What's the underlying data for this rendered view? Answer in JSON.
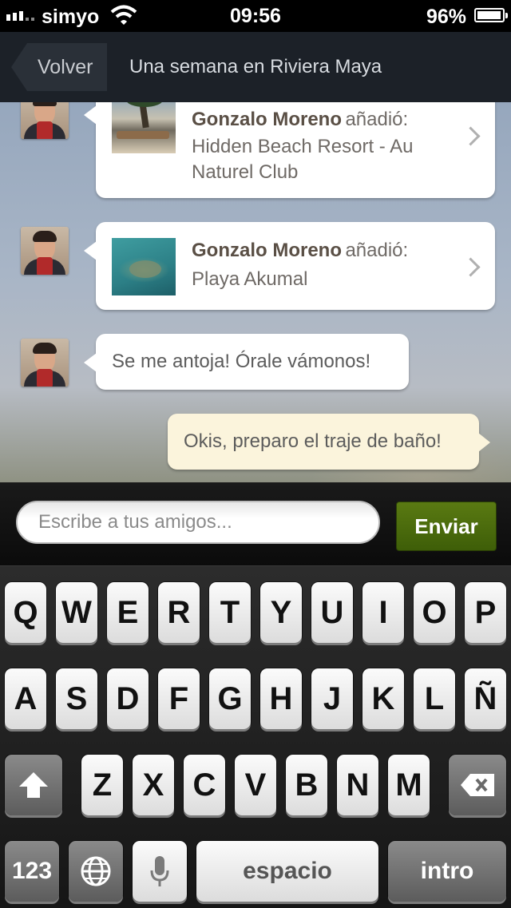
{
  "status_bar": {
    "carrier": "simyo",
    "time": "09:56",
    "battery_percent": "96%",
    "battery_level": 0.96
  },
  "nav": {
    "back_label": "Volver",
    "title": "Una semana en Riviera Maya"
  },
  "messages": [
    {
      "type": "activity",
      "author": "Gonzalo Moreno",
      "action": "añadió:",
      "place": "Hidden Beach Resort - Au Naturel Club",
      "thumbnail": "beach-resort-photo"
    },
    {
      "type": "activity",
      "author": "Gonzalo Moreno",
      "action": "añadió:",
      "place": "Playa Akumal",
      "thumbnail": "underwater-turtle-photo"
    },
    {
      "type": "text",
      "text": "Se me antoja! Órale vámonos!"
    },
    {
      "type": "text-own",
      "text": "Okis, preparo el traje de baño!"
    }
  ],
  "composer": {
    "placeholder": "Escribe a tus amigos...",
    "value": "",
    "send_label": "Enviar"
  },
  "keyboard": {
    "row1": [
      "Q",
      "W",
      "E",
      "R",
      "T",
      "Y",
      "U",
      "I",
      "O",
      "P"
    ],
    "row2": [
      "A",
      "S",
      "D",
      "F",
      "G",
      "H",
      "J",
      "K",
      "L",
      "Ñ"
    ],
    "row3": [
      "Z",
      "X",
      "C",
      "V",
      "B",
      "N",
      "M"
    ],
    "numbers_label": "123",
    "space_label": "espacio",
    "return_label": "intro",
    "icons": {
      "shift": "shift-arrow-icon",
      "delete": "backspace-icon",
      "globe": "globe-icon",
      "mic": "microphone-icon"
    }
  },
  "colors": {
    "send_button": "#4a6a0e",
    "nav_bar": "#1c2128",
    "own_bubble": "#fbf4dc"
  }
}
